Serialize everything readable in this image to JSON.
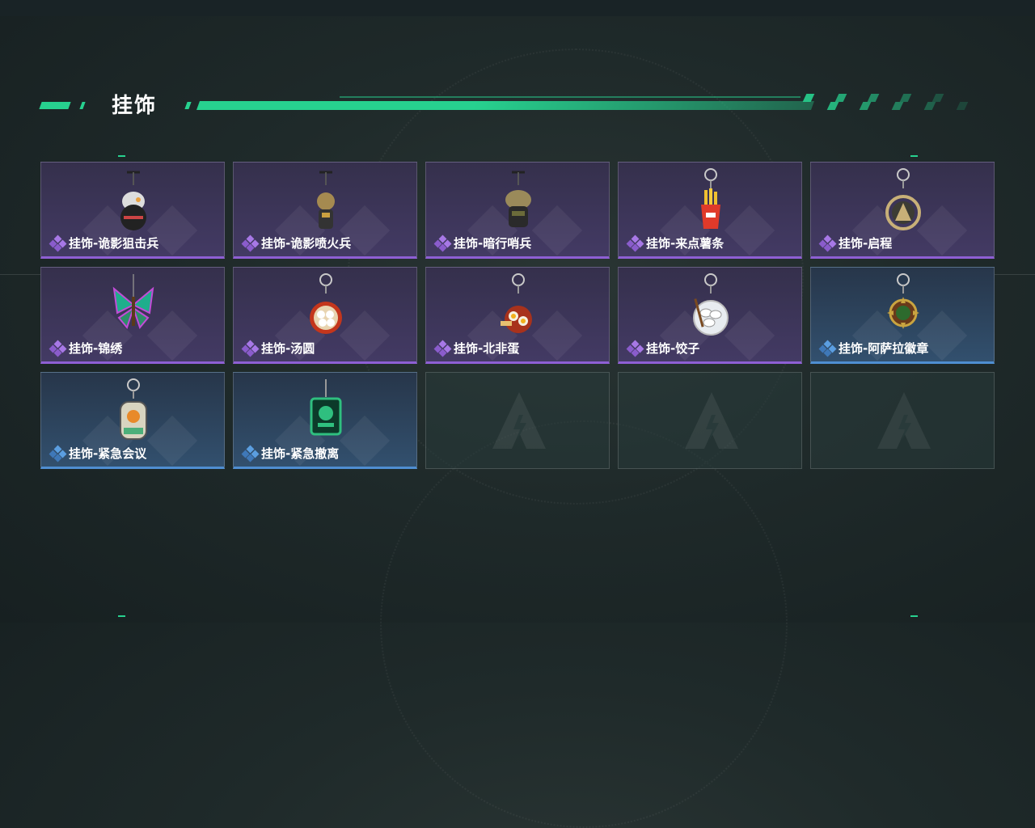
{
  "page": {
    "title": "挂饰"
  },
  "colors": {
    "accent": "#27d18f",
    "purple_rarity": "#8e5fd4",
    "blue_rarity": "#4f8ed1"
  },
  "items": [
    {
      "label": "挂饰-诡影狙击兵",
      "rarity": "purple",
      "icon": "sniper-figure-charm-icon"
    },
    {
      "label": "挂饰-诡影喷火兵",
      "rarity": "purple",
      "icon": "flamethrower-figure-charm-icon"
    },
    {
      "label": "挂饰-暗行哨兵",
      "rarity": "purple",
      "icon": "sentinel-figure-charm-icon"
    },
    {
      "label": "挂饰-来点薯条",
      "rarity": "purple",
      "icon": "fries-charm-icon"
    },
    {
      "label": "挂饰-启程",
      "rarity": "purple",
      "icon": "medallion-charm-icon"
    },
    {
      "label": "挂饰-锦绣",
      "rarity": "purple",
      "icon": "butterfly-charm-icon"
    },
    {
      "label": "挂饰-汤圆",
      "rarity": "purple",
      "icon": "tangyuan-bowl-charm-icon"
    },
    {
      "label": "挂饰-北非蛋",
      "rarity": "purple",
      "icon": "shakshuka-charm-icon"
    },
    {
      "label": "挂饰-饺子",
      "rarity": "purple",
      "icon": "dumpling-plate-charm-icon"
    },
    {
      "label": "挂饰-阿萨拉徽章",
      "rarity": "blue",
      "icon": "asala-badge-charm-icon"
    },
    {
      "label": "挂饰-紧急会议",
      "rarity": "blue",
      "icon": "emergency-meeting-charm-icon"
    },
    {
      "label": "挂饰-紧急撤离",
      "rarity": "blue",
      "icon": "emergency-evac-charm-icon"
    },
    {
      "label": "",
      "rarity": "empty",
      "icon": "empty-slot-logo-icon"
    },
    {
      "label": "",
      "rarity": "empty",
      "icon": "empty-slot-logo-icon"
    },
    {
      "label": "",
      "rarity": "empty",
      "icon": "empty-slot-logo-icon"
    }
  ]
}
